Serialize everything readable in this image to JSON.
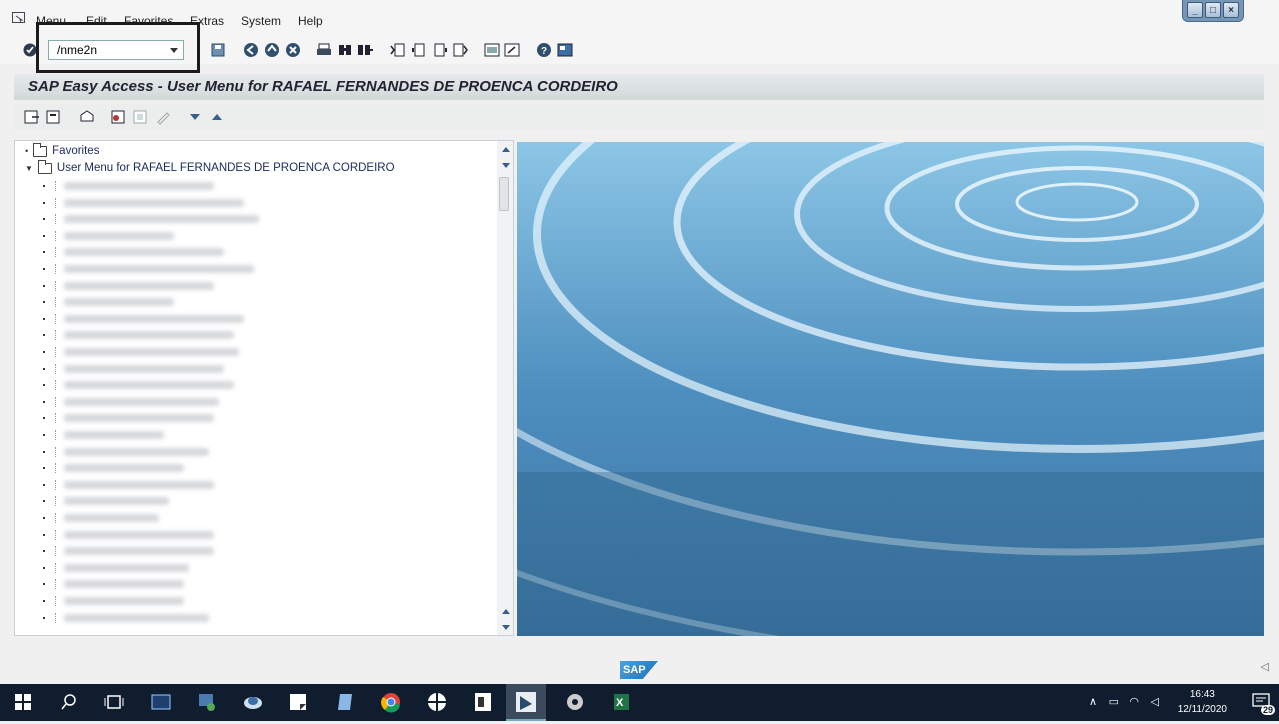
{
  "menu": {
    "items": [
      "Menu",
      "Edit",
      "Favorites",
      "Extras",
      "System",
      "Help"
    ]
  },
  "window_controls": [
    "_",
    "□",
    "×"
  ],
  "command_field": {
    "value": "/nme2n"
  },
  "title": "SAP Easy Access  -  User Menu for RAFAEL FERNANDES DE PROENCA CORDEIRO",
  "tree": {
    "favorites": "Favorites",
    "user_menu": "User Menu for RAFAEL FERNANDES DE PROENCA CORDEIRO",
    "hidden_rows": 27
  },
  "footer": {
    "logo": "SAP"
  },
  "taskbar": {
    "time": "16:43",
    "date": "12/11/2020",
    "notification_count": "29"
  },
  "colors": {
    "accent": "#3a5f8a",
    "title_bg": "#d8dddd",
    "taskbar": "#0f1d2e"
  }
}
